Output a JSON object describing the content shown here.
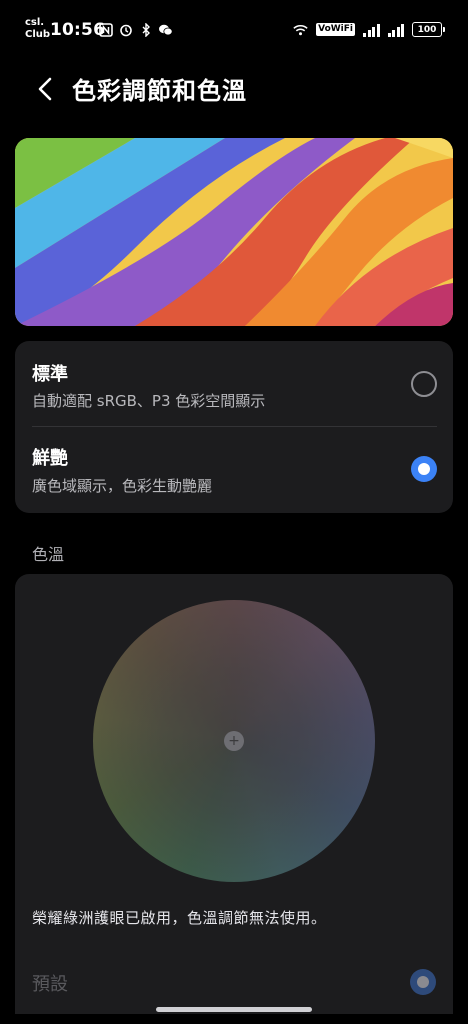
{
  "status_bar": {
    "carrier_line1": "csl.",
    "carrier_line2": "Club",
    "time": "10:56",
    "vowifi": "VoWiFi",
    "battery": "100"
  },
  "header": {
    "title": "色彩調節和色溫"
  },
  "display_mode": {
    "options": [
      {
        "title": "標準",
        "subtitle": "自動適配 sRGB、P3 色彩空間顯示",
        "selected": false
      },
      {
        "title": "鮮艷",
        "subtitle": "廣色域顯示，色彩生動艷麗",
        "selected": true
      }
    ]
  },
  "color_temperature": {
    "section_label": "色溫",
    "center_symbol": "+",
    "notice": "榮耀綠洲護眼已啟用，色溫調節無法使用。",
    "preset_label": "預設",
    "preset_selected": true
  },
  "colors": {
    "accent": "#3b82f6",
    "card_bg": "#1c1c1e",
    "background": "#000000"
  }
}
